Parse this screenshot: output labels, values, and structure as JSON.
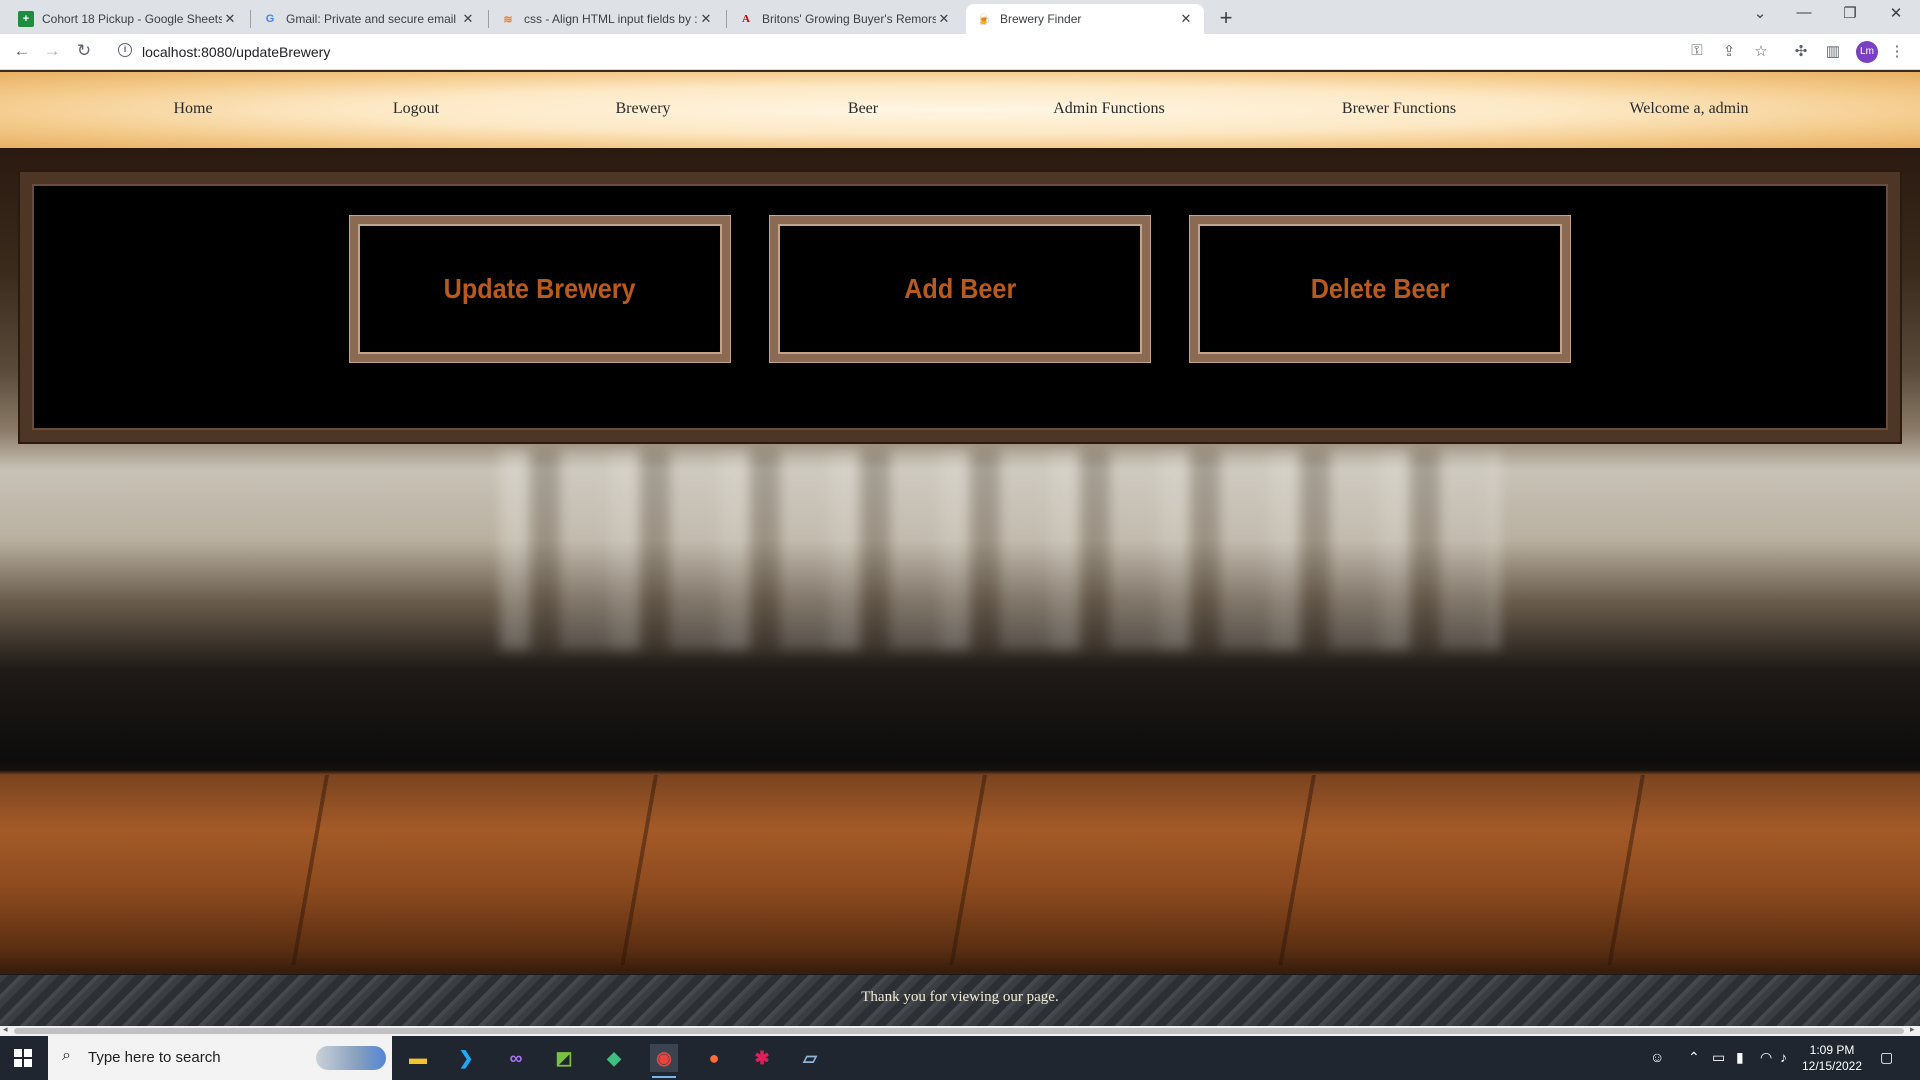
{
  "browser": {
    "tabs": [
      {
        "title": "Cohort 18 Pickup - Google Sheets",
        "icon": "sheets-icon",
        "active": false
      },
      {
        "title": "Gmail: Private and secure email at no cost",
        "icon": "google-icon",
        "active": false
      },
      {
        "title": "css - Align HTML input fields by :",
        "icon": "stackoverflow-icon",
        "active": false
      },
      {
        "title": "Britons' Growing Buyer's Remorse",
        "icon": "atlantic-icon",
        "active": false
      },
      {
        "title": "Brewery Finder",
        "icon": "beer-icon",
        "active": true
      }
    ],
    "url": "localhost:8080/updateBrewery",
    "profile_initials": "Lm"
  },
  "nav": {
    "links": [
      "Home",
      "Logout",
      "Brewery",
      "Beer",
      "Admin Functions",
      "Brewer Functions"
    ],
    "welcome": "Welcome a, admin"
  },
  "actions": [
    "Update Brewery",
    "Add Beer",
    "Delete Beer"
  ],
  "footer": {
    "text": "Thank you for viewing our page."
  },
  "taskbar": {
    "search_placeholder": "Type here to search",
    "time": "1:09 PM",
    "date": "12/15/2022"
  },
  "colors": {
    "action_text": "#b85a1c",
    "navbar": "#fde8c4",
    "footer_text": "#f2ead8"
  }
}
